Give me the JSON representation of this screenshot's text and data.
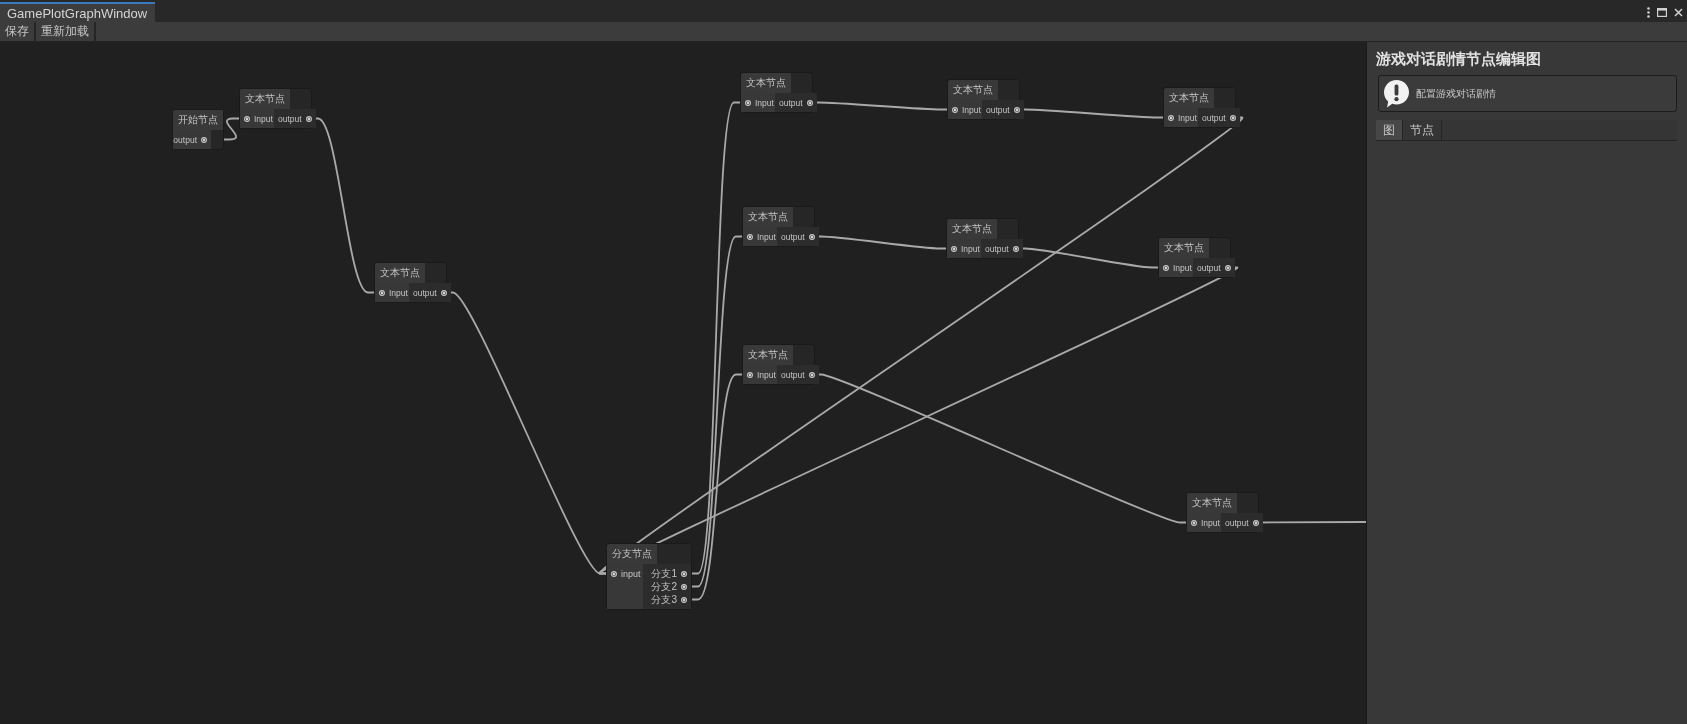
{
  "window": {
    "tab": {
      "label": "GamePlotGraphWindow",
      "selected": true
    }
  },
  "toolbar": {
    "buttons": [
      "保存",
      "重新加载"
    ]
  },
  "graph": {
    "nodes": [
      {
        "kind": "start",
        "title": "开始节点",
        "outputs": [
          "output"
        ]
      },
      {
        "kind": "text",
        "title": "文本节点",
        "inputs": [
          "Input"
        ],
        "outputs": [
          "output"
        ]
      },
      {
        "kind": "text",
        "title": "文本节点",
        "inputs": [
          "Input"
        ],
        "outputs": [
          "output"
        ]
      },
      {
        "kind": "branch",
        "title": "分支节点",
        "inputs": [
          "input"
        ],
        "outputs": [
          "分支1",
          "分支2",
          "分支3"
        ]
      },
      {
        "kind": "text",
        "title": "文本节点",
        "inputs": [
          "Input"
        ],
        "outputs": [
          "output"
        ]
      },
      {
        "kind": "text",
        "title": "文本节点",
        "inputs": [
          "Input"
        ],
        "outputs": [
          "output"
        ]
      },
      {
        "kind": "text",
        "title": "文本节点",
        "inputs": [
          "Input"
        ],
        "outputs": [
          "output"
        ]
      },
      {
        "kind": "text",
        "title": "文本节点",
        "inputs": [
          "Input"
        ],
        "outputs": [
          "output"
        ]
      },
      {
        "kind": "text",
        "title": "文本节点",
        "inputs": [
          "Input"
        ],
        "outputs": [
          "output"
        ]
      },
      {
        "kind": "text",
        "title": "文本节点",
        "inputs": [
          "Input"
        ],
        "outputs": [
          "output"
        ]
      },
      {
        "kind": "text",
        "title": "文本节点",
        "inputs": [
          "Input"
        ],
        "outputs": [
          "output"
        ]
      },
      {
        "kind": "text",
        "title": "文本节点",
        "inputs": [
          "Input"
        ],
        "outputs": [
          "output"
        ]
      }
    ]
  },
  "inspector": {
    "title": "游戏对话剧情节点编辑图",
    "help_box": {
      "text": "配置游戏对话剧情"
    },
    "tabs": [
      {
        "label": "图",
        "selected": true
      },
      {
        "label": "节点",
        "selected": false
      }
    ]
  }
}
